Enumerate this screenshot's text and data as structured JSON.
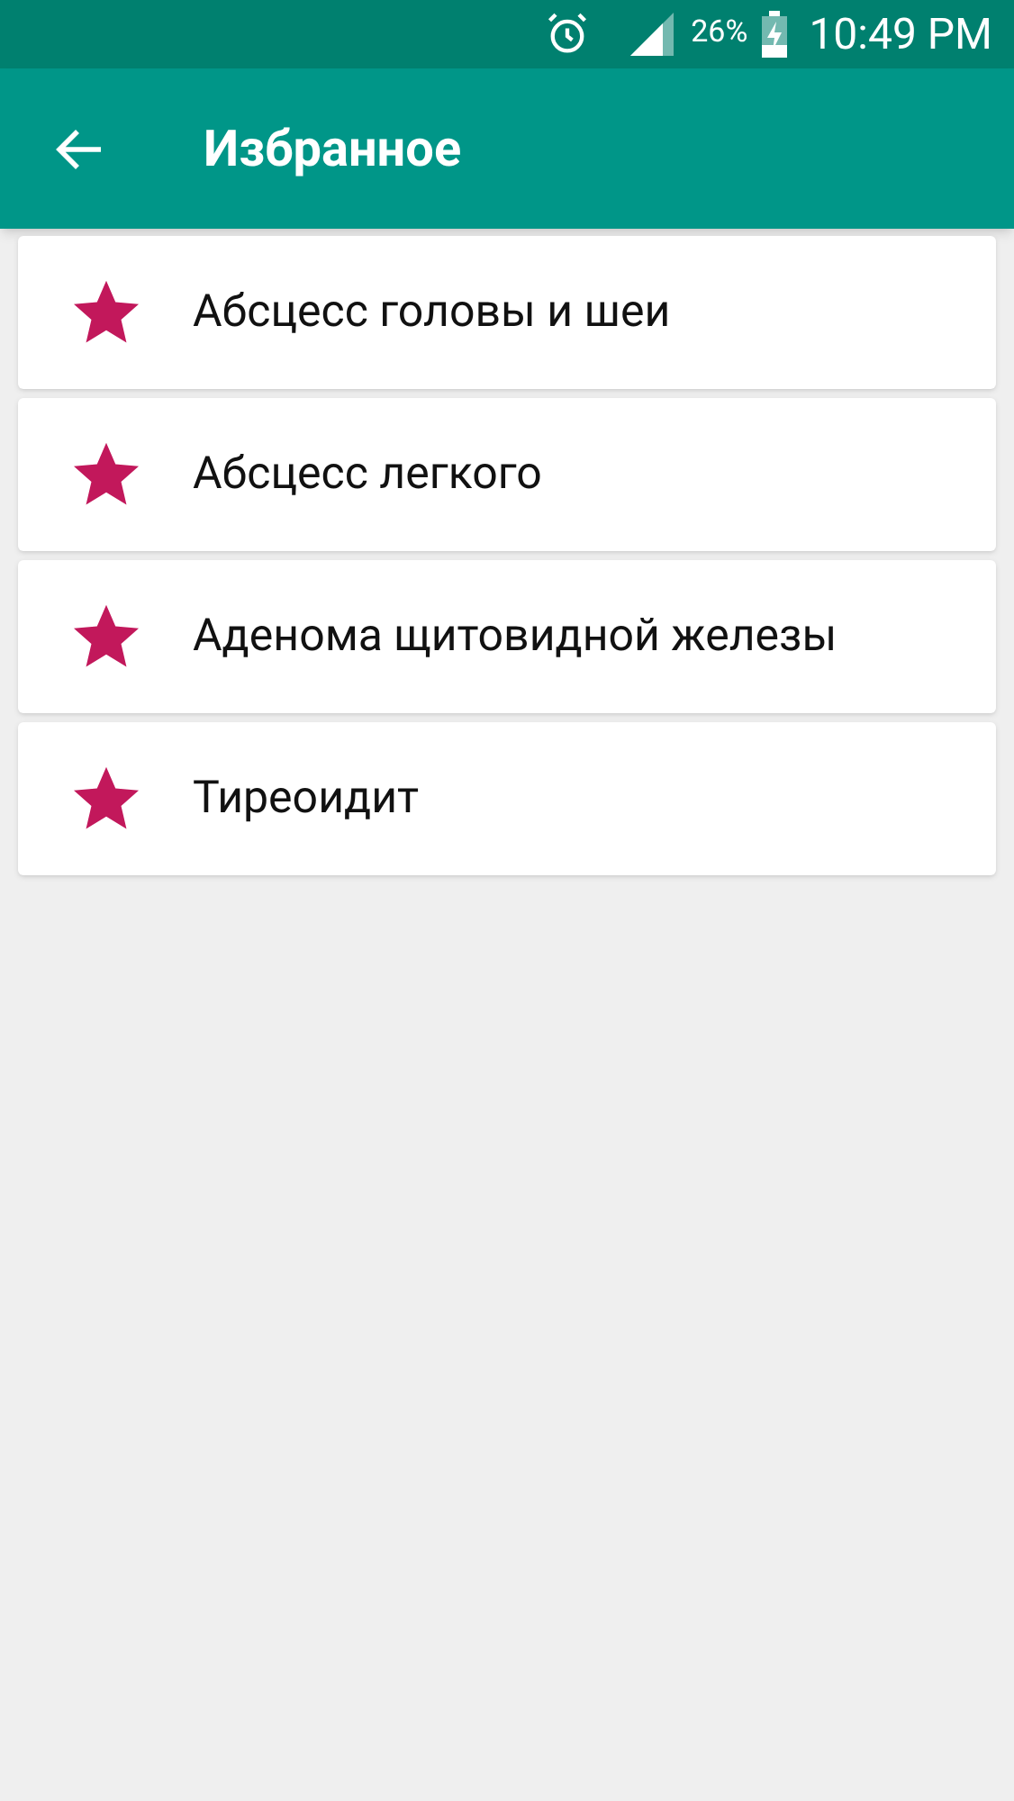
{
  "status_bar": {
    "battery": "26%",
    "time": "10:49 PM"
  },
  "toolbar": {
    "title": "Избранное"
  },
  "items": [
    {
      "label": "Абсцесс головы и шеи",
      "starred": true
    },
    {
      "label": "Абсцесс легкого",
      "starred": true
    },
    {
      "label": "Аденома щитовидной железы",
      "starred": true
    },
    {
      "label": "Тиреоидит",
      "starred": true
    }
  ]
}
